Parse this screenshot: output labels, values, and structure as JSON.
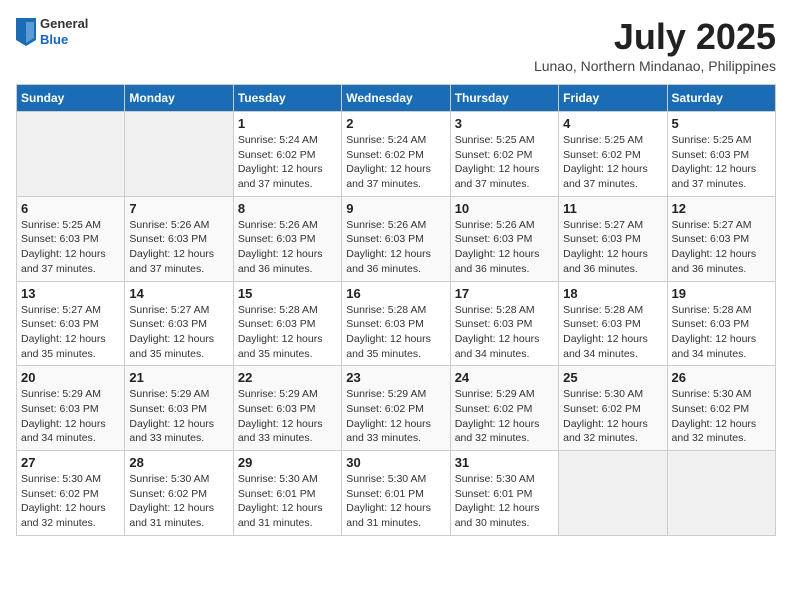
{
  "header": {
    "logo": {
      "general": "General",
      "blue": "Blue"
    },
    "title": "July 2025",
    "location": "Lunao, Northern Mindanao, Philippines"
  },
  "days_of_week": [
    "Sunday",
    "Monday",
    "Tuesday",
    "Wednesday",
    "Thursday",
    "Friday",
    "Saturday"
  ],
  "weeks": [
    [
      {
        "day": "",
        "info": ""
      },
      {
        "day": "",
        "info": ""
      },
      {
        "day": "1",
        "info": "Sunrise: 5:24 AM\nSunset: 6:02 PM\nDaylight: 12 hours and 37 minutes."
      },
      {
        "day": "2",
        "info": "Sunrise: 5:24 AM\nSunset: 6:02 PM\nDaylight: 12 hours and 37 minutes."
      },
      {
        "day": "3",
        "info": "Sunrise: 5:25 AM\nSunset: 6:02 PM\nDaylight: 12 hours and 37 minutes."
      },
      {
        "day": "4",
        "info": "Sunrise: 5:25 AM\nSunset: 6:02 PM\nDaylight: 12 hours and 37 minutes."
      },
      {
        "day": "5",
        "info": "Sunrise: 5:25 AM\nSunset: 6:03 PM\nDaylight: 12 hours and 37 minutes."
      }
    ],
    [
      {
        "day": "6",
        "info": "Sunrise: 5:25 AM\nSunset: 6:03 PM\nDaylight: 12 hours and 37 minutes."
      },
      {
        "day": "7",
        "info": "Sunrise: 5:26 AM\nSunset: 6:03 PM\nDaylight: 12 hours and 37 minutes."
      },
      {
        "day": "8",
        "info": "Sunrise: 5:26 AM\nSunset: 6:03 PM\nDaylight: 12 hours and 36 minutes."
      },
      {
        "day": "9",
        "info": "Sunrise: 5:26 AM\nSunset: 6:03 PM\nDaylight: 12 hours and 36 minutes."
      },
      {
        "day": "10",
        "info": "Sunrise: 5:26 AM\nSunset: 6:03 PM\nDaylight: 12 hours and 36 minutes."
      },
      {
        "day": "11",
        "info": "Sunrise: 5:27 AM\nSunset: 6:03 PM\nDaylight: 12 hours and 36 minutes."
      },
      {
        "day": "12",
        "info": "Sunrise: 5:27 AM\nSunset: 6:03 PM\nDaylight: 12 hours and 36 minutes."
      }
    ],
    [
      {
        "day": "13",
        "info": "Sunrise: 5:27 AM\nSunset: 6:03 PM\nDaylight: 12 hours and 35 minutes."
      },
      {
        "day": "14",
        "info": "Sunrise: 5:27 AM\nSunset: 6:03 PM\nDaylight: 12 hours and 35 minutes."
      },
      {
        "day": "15",
        "info": "Sunrise: 5:28 AM\nSunset: 6:03 PM\nDaylight: 12 hours and 35 minutes."
      },
      {
        "day": "16",
        "info": "Sunrise: 5:28 AM\nSunset: 6:03 PM\nDaylight: 12 hours and 35 minutes."
      },
      {
        "day": "17",
        "info": "Sunrise: 5:28 AM\nSunset: 6:03 PM\nDaylight: 12 hours and 34 minutes."
      },
      {
        "day": "18",
        "info": "Sunrise: 5:28 AM\nSunset: 6:03 PM\nDaylight: 12 hours and 34 minutes."
      },
      {
        "day": "19",
        "info": "Sunrise: 5:28 AM\nSunset: 6:03 PM\nDaylight: 12 hours and 34 minutes."
      }
    ],
    [
      {
        "day": "20",
        "info": "Sunrise: 5:29 AM\nSunset: 6:03 PM\nDaylight: 12 hours and 34 minutes."
      },
      {
        "day": "21",
        "info": "Sunrise: 5:29 AM\nSunset: 6:03 PM\nDaylight: 12 hours and 33 minutes."
      },
      {
        "day": "22",
        "info": "Sunrise: 5:29 AM\nSunset: 6:03 PM\nDaylight: 12 hours and 33 minutes."
      },
      {
        "day": "23",
        "info": "Sunrise: 5:29 AM\nSunset: 6:02 PM\nDaylight: 12 hours and 33 minutes."
      },
      {
        "day": "24",
        "info": "Sunrise: 5:29 AM\nSunset: 6:02 PM\nDaylight: 12 hours and 32 minutes."
      },
      {
        "day": "25",
        "info": "Sunrise: 5:30 AM\nSunset: 6:02 PM\nDaylight: 12 hours and 32 minutes."
      },
      {
        "day": "26",
        "info": "Sunrise: 5:30 AM\nSunset: 6:02 PM\nDaylight: 12 hours and 32 minutes."
      }
    ],
    [
      {
        "day": "27",
        "info": "Sunrise: 5:30 AM\nSunset: 6:02 PM\nDaylight: 12 hours and 32 minutes."
      },
      {
        "day": "28",
        "info": "Sunrise: 5:30 AM\nSunset: 6:02 PM\nDaylight: 12 hours and 31 minutes."
      },
      {
        "day": "29",
        "info": "Sunrise: 5:30 AM\nSunset: 6:01 PM\nDaylight: 12 hours and 31 minutes."
      },
      {
        "day": "30",
        "info": "Sunrise: 5:30 AM\nSunset: 6:01 PM\nDaylight: 12 hours and 31 minutes."
      },
      {
        "day": "31",
        "info": "Sunrise: 5:30 AM\nSunset: 6:01 PM\nDaylight: 12 hours and 30 minutes."
      },
      {
        "day": "",
        "info": ""
      },
      {
        "day": "",
        "info": ""
      }
    ]
  ]
}
